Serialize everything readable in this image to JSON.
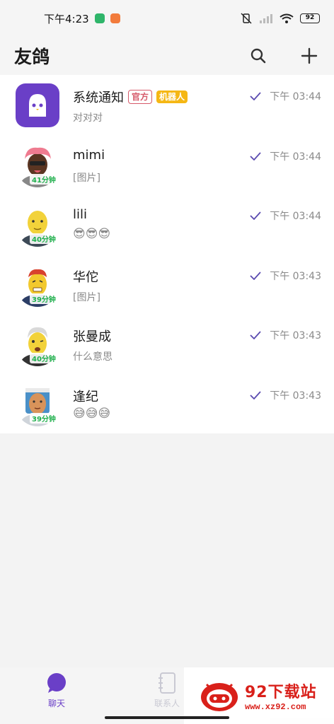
{
  "status_bar": {
    "time": "下午4:23",
    "battery": "92"
  },
  "header": {
    "title": "友鸽"
  },
  "chats": [
    {
      "name": "系统通知",
      "tag_official": "官方",
      "tag_robot": "机器人",
      "preview": "对对对",
      "time": "下午 03:44",
      "badge": ""
    },
    {
      "name": "mimi",
      "preview": "[图片]",
      "time": "下午 03:44",
      "badge": "41分钟"
    },
    {
      "name": "lili",
      "preview": "😎😎😎",
      "time": "下午 03:44",
      "badge": "40分钟"
    },
    {
      "name": "华佗",
      "preview": "[图片]",
      "time": "下午 03:43",
      "badge": "39分钟"
    },
    {
      "name": "张曼成",
      "preview": "什么意思",
      "time": "下午 03:43",
      "badge": "40分钟"
    },
    {
      "name": "逢纪",
      "preview": "😅😅😅",
      "time": "下午 03:43",
      "badge": "39分钟"
    }
  ],
  "bottom_nav": {
    "chat_label": "聊天",
    "contacts_label": "联系人"
  },
  "watermark": {
    "title": "92下载站",
    "url": "www.xz92.com"
  },
  "colors": {
    "accent": "#6a3fc7",
    "badge_green": "#20b04d",
    "tag_red": "#d65a6a",
    "tag_yellow": "#f5b714"
  }
}
